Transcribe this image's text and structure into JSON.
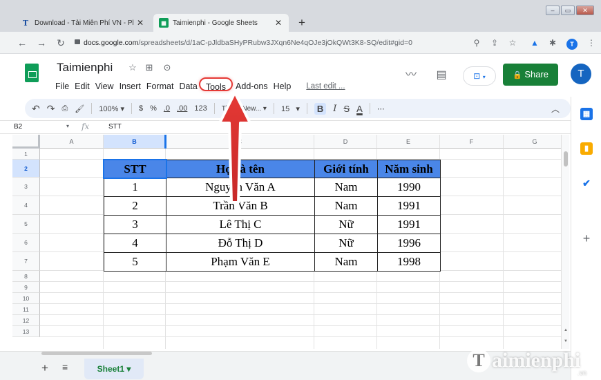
{
  "browser": {
    "tabs": [
      {
        "title": "Download - Tải Miễn Phí VN - Pl",
        "favicon": "T"
      },
      {
        "title": "Taimienphi - Google Sheets",
        "favicon": "sheets-icon"
      }
    ],
    "new_tab": "+",
    "url_domain": "docs.google.com",
    "url_path": "/spreadsheets/d/1aC-pJldbaSHyPRubw3JXqn6Ne4qOJe3jOkQWt3K8-SQ/edit#gid=0",
    "profile_initial": "T"
  },
  "sheets": {
    "title": "Taimienphi",
    "menu": [
      "File",
      "Edit",
      "View",
      "Insert",
      "Format",
      "Data",
      "Tools",
      "Add-ons",
      "Help"
    ],
    "last_edit": "Last edit ...",
    "share_label": "Share",
    "avatar_initial": "T"
  },
  "toolbar": {
    "zoom": "100%",
    "currency": "$",
    "percent": "%",
    "dec_decrease": ".0",
    "dec_increase": ".00",
    "more_formats": "123",
    "font": "Times New...",
    "font_size": "15",
    "bold": "B",
    "italic": "I",
    "strike": "S",
    "text_color": "A",
    "more": "⋯"
  },
  "formula_bar": {
    "cell_ref": "B2",
    "fx": "fx",
    "value": "STT"
  },
  "grid": {
    "columns": [
      "A",
      "B",
      "C",
      "D",
      "E",
      "F",
      "G"
    ],
    "rows": [
      "1",
      "2",
      "3",
      "4",
      "5",
      "6",
      "7",
      "8",
      "9",
      "10",
      "11",
      "12",
      "13"
    ],
    "selected_column": "B",
    "selected_row": "2"
  },
  "table": {
    "headers": [
      "STT",
      "Họ và tên",
      "Giới tính",
      "Năm sinh"
    ],
    "rows": [
      [
        "1",
        "Nguyễn Văn A",
        "Nam",
        "1990"
      ],
      [
        "2",
        "Trần Văn B",
        "Nam",
        "1991"
      ],
      [
        "3",
        "Lê Thị C",
        "Nữ",
        "1991"
      ],
      [
        "4",
        "Đỗ Thị D",
        "Nữ",
        "1996"
      ],
      [
        "5",
        "Phạm Văn E",
        "Nam",
        "1998"
      ]
    ],
    "header_color": "#4a86e8"
  },
  "bottom": {
    "sheet_tab": "Sheet1 ▾"
  },
  "annotation": {
    "highlight_color": "#e53935"
  },
  "watermark": {
    "brand": "aimienphi",
    "brand_initial": "T",
    "suffix": ".vn"
  }
}
